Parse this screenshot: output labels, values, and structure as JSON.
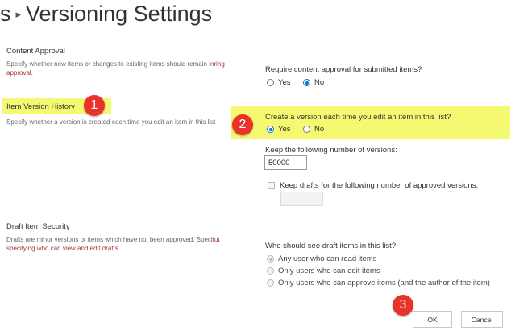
{
  "header": {
    "breadcrumb_prev": "s",
    "separator": "▸",
    "title": "Versioning Settings"
  },
  "content_approval": {
    "title": "Content Approval",
    "desc_line1": "Specify whether new items or changes to existing items should remain in",
    "desc_line1_link": "ring",
    "desc_line2_link": "approval.",
    "question": "Require content approval for submitted items?",
    "options": [
      "Yes",
      "No"
    ],
    "selected": "No"
  },
  "version_history": {
    "title": "Item Version History",
    "desc": "Specify whether a version is created each time you edit an item in this list",
    "question": "Create a version each time you edit an item in this list?",
    "options": [
      "Yes",
      "No"
    ],
    "selected": "Yes",
    "keep_label": "Keep the following number of versions:",
    "keep_value": "50000",
    "drafts_label": "Keep drafts for the following number of approved versions:",
    "drafts_value": ""
  },
  "draft_security": {
    "title": "Draft Item Security",
    "desc_line1": "Drafts are minor versions or items which have not been approved. Specif",
    "desc_line1_link": "ut",
    "desc_line2_link": "specifying who can view and edit drafts.",
    "question": "Who should see draft items in this list?",
    "options": [
      "Any user who can read items",
      "Only users who can edit items",
      "Only users who can approve items (and the author of the item)"
    ],
    "selected": "Any user who can read items"
  },
  "buttons": {
    "ok": "OK",
    "cancel": "Cancel"
  },
  "callouts": [
    "1",
    "2",
    "3"
  ],
  "colors": {
    "highlight": "#f5f871",
    "callout": "#e8322a",
    "radio_selected": "#0078d4",
    "link_text": "#a33333"
  }
}
